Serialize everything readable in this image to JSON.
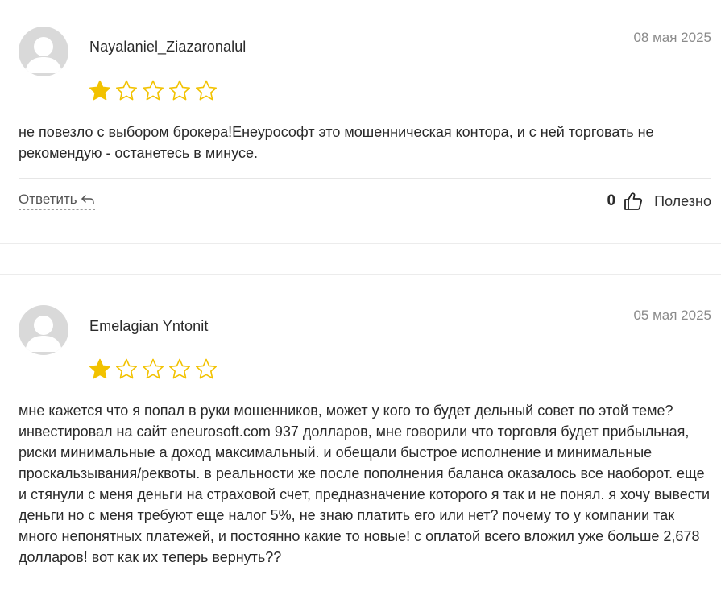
{
  "colors": {
    "star_filled": "#f2c200",
    "star_empty_stroke": "#f2c200",
    "avatar_bg": "#d9d9d9",
    "avatar_fg": "#ffffff"
  },
  "reviews": [
    {
      "author": "Nayalaniel_Ziazaronalul",
      "date": "08 мая 2025",
      "rating": 1,
      "max_rating": 5,
      "text": "не повезло с выбором брокера!Енеурософт это мошенническая контора, и с ней торговать не рекомендую - останетесь в минусе.",
      "reply_label": "Ответить",
      "reply_icon": "reply-arrow-icon",
      "helpful_count": "0",
      "helpful_icon": "thumbs-up-icon",
      "helpful_label": "Полезно"
    },
    {
      "author": "Emelagian Yntonit",
      "date": "05 мая 2025",
      "rating": 1,
      "max_rating": 5,
      "text": "мне кажется что я попал в руки мошенников, может у кого то будет дельный совет по этой теме? инвестировал на сайт eneurosoft.com 937 долларов, мне говорили что торговля будет прибыльная, риски минимальные а доход максимальный. и обещали быстрое исполнение и минимальные проскальзывания/реквоты. в реальности же после пополнения баланса оказалось все наоборот. еще и стянули с меня деньги на страховой счет, предназначение которого я так и не понял. я хочу вывести деньги но с меня требуют еще налог 5%, не знаю платить его или нет? почему то у компании так много непонятных платежей, и постоянно какие то новые! с оплатой всего вложил уже больше 2,678 долларов! вот как их теперь вернуть??"
    }
  ]
}
